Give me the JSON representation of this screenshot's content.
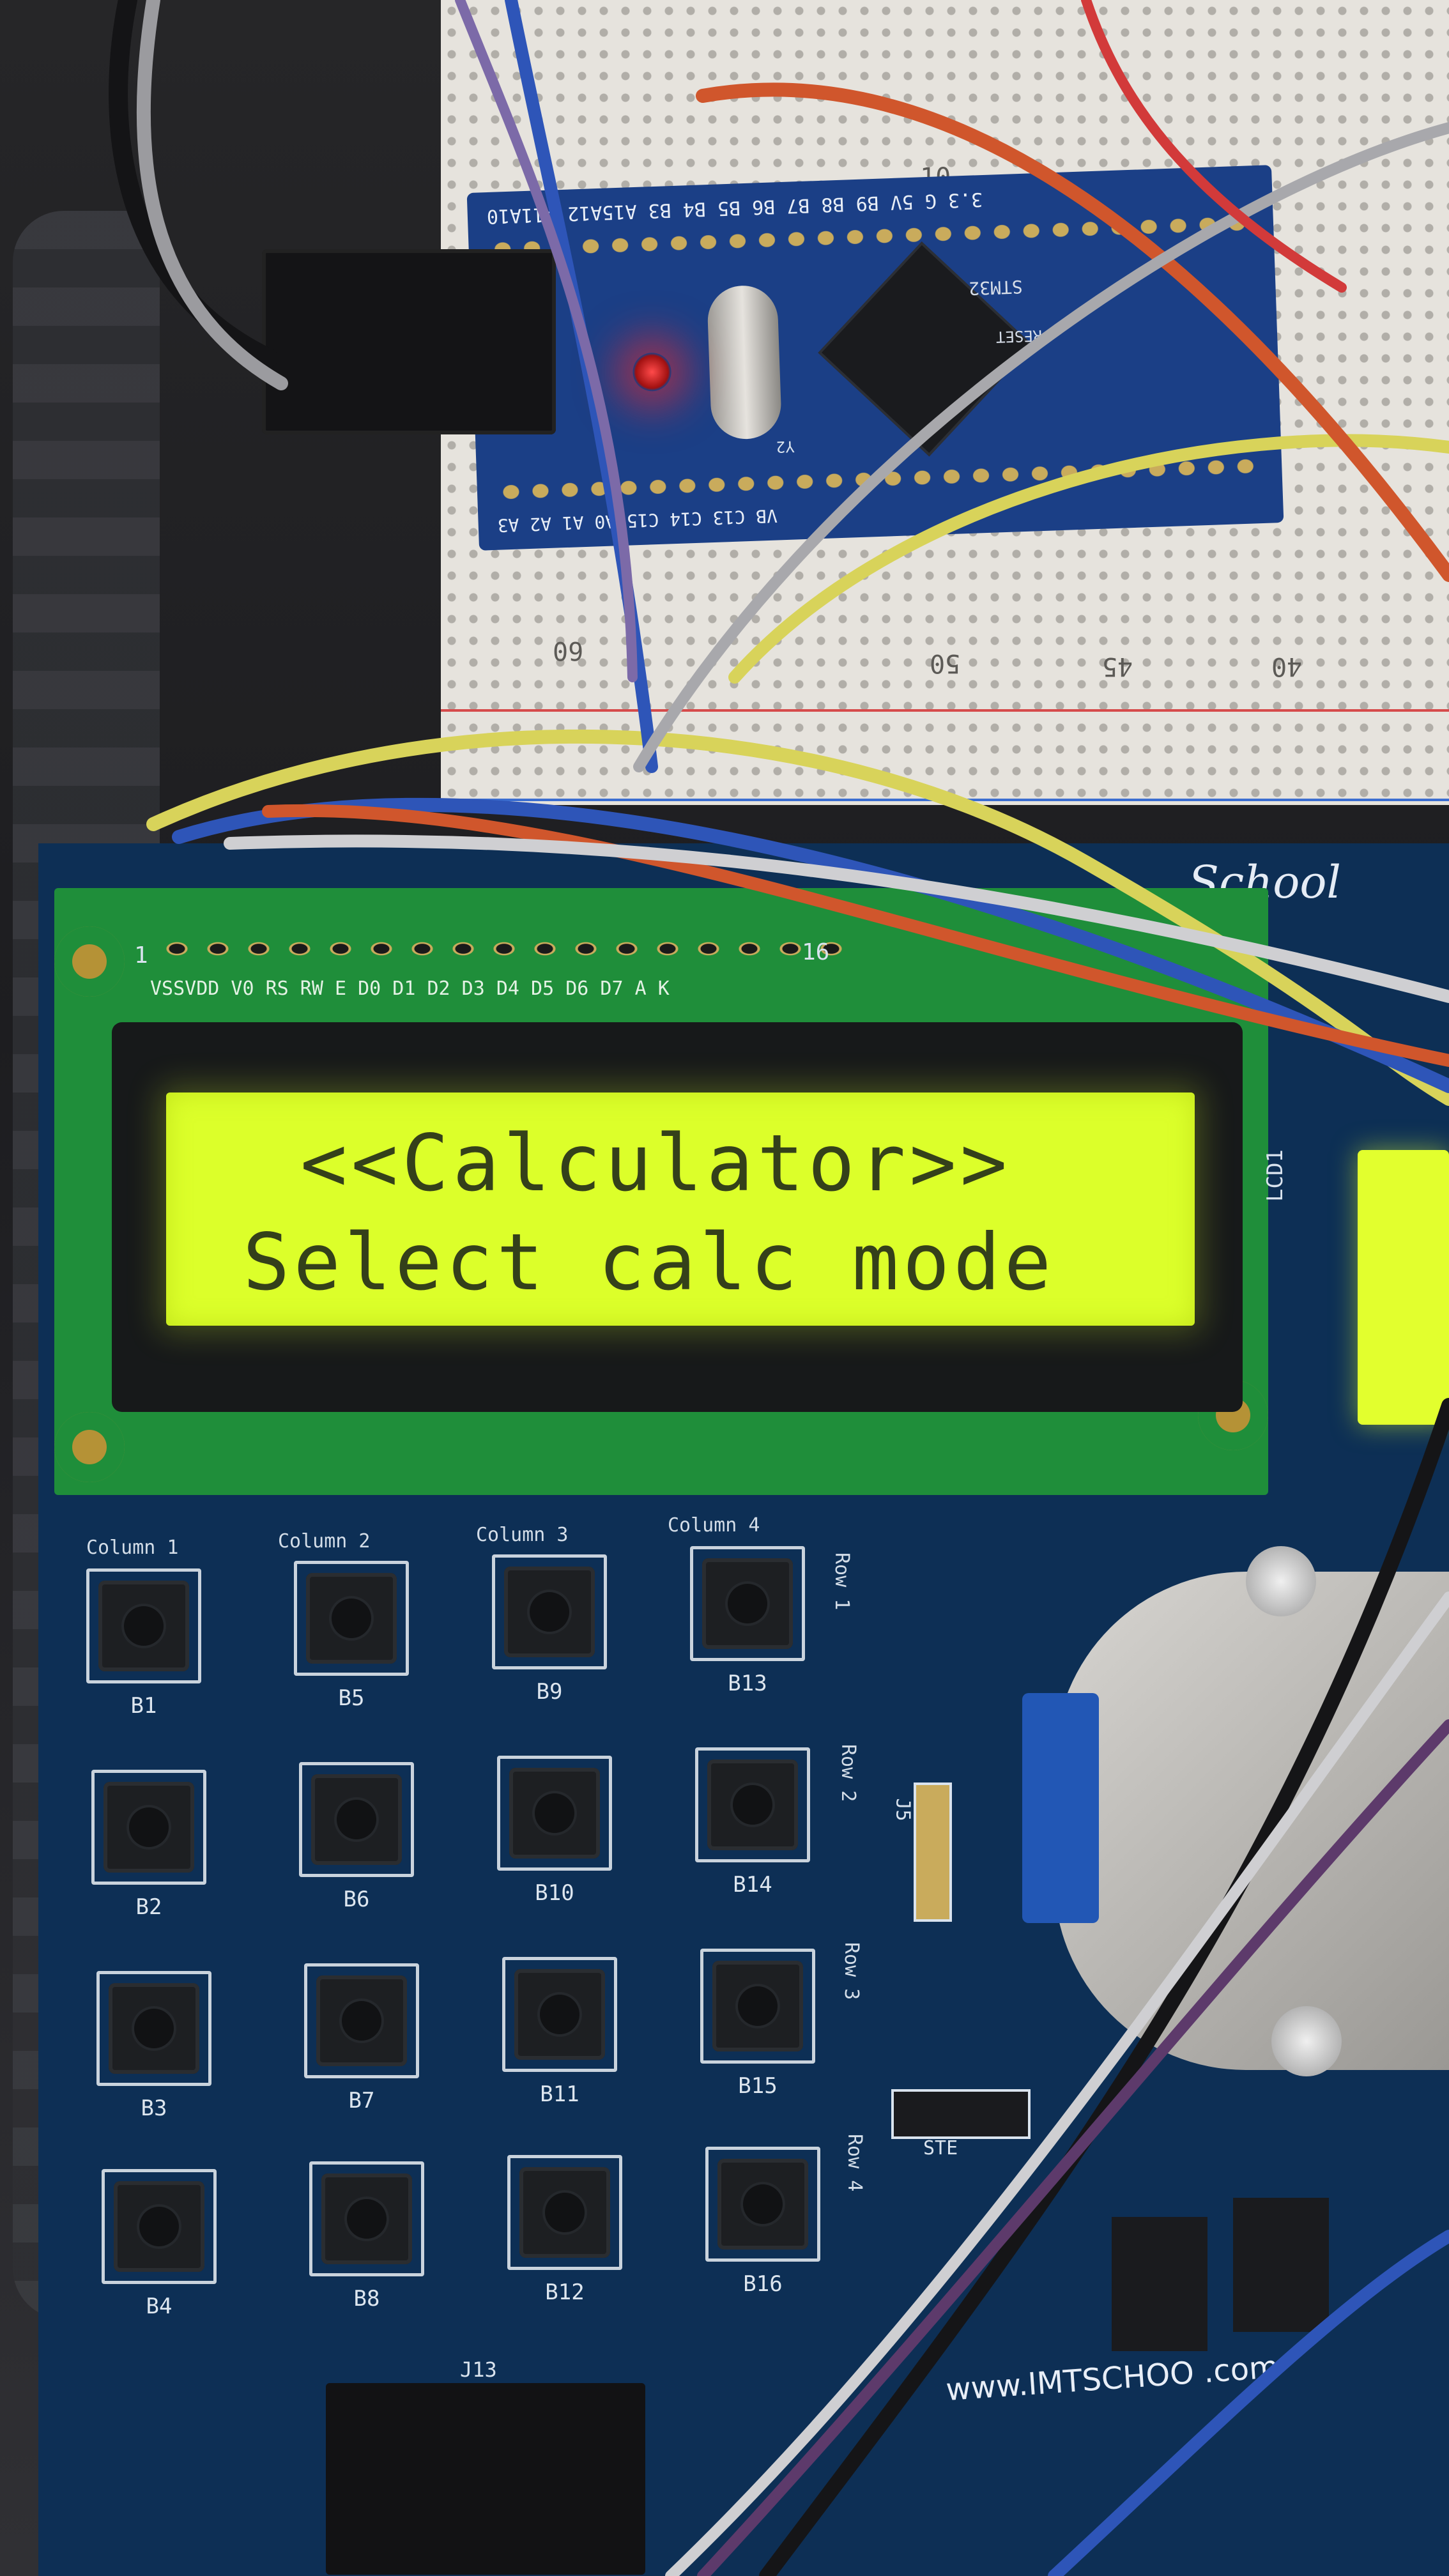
{
  "lcd": {
    "line1": "<<Calculator>>",
    "line2": "Select calc mode",
    "pin_header": "VSSVDD V0 RS RW E  D0 D1 D2 D3 D4 D5 D6 D7  A  K",
    "pin_first": "1",
    "pin_last": "16",
    "led_label": "LCD1",
    "backlight_color": "#dcff2a"
  },
  "board": {
    "brand_top": "School",
    "website": "www.IMTSCHOO .com",
    "header_label": "J13",
    "stepper_label": "STE",
    "jumper_label": "J5",
    "pcb_color": "#0d2f55"
  },
  "keypad": {
    "columns": [
      "Column 1",
      "Column 2",
      "Column 3",
      "Column 4"
    ],
    "rows": [
      "Row 1",
      "Row 2",
      "Row 3",
      "Row 4"
    ],
    "buttons": [
      "B1",
      "B5",
      "B9",
      "B13",
      "B2",
      "B6",
      "B10",
      "B14",
      "B3",
      "B7",
      "B11",
      "B15",
      "B4",
      "B8",
      "B12",
      "B16"
    ]
  },
  "mcu": {
    "top_pins": "3.3 G  5V B9 B8 B7 B6 B5 B4 B3 A15A12 A11A10",
    "bottom_pins": "VB C13 C14 C15 A0 A1 A2 A3",
    "chip_label": "STM32",
    "reset_label": "RESET",
    "crystal_label": "Y2"
  },
  "breadboard": {
    "numbers": [
      "10",
      "60",
      "50",
      "45",
      "40"
    ]
  }
}
